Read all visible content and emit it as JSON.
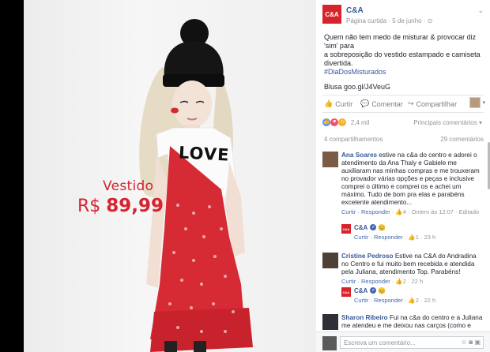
{
  "post_image": {
    "price_label": "Vestido",
    "currency": "R$",
    "price_value": "89,99",
    "shirt_text": "LOVE"
  },
  "header": {
    "page_name": "C&A",
    "logo_text": "C&A",
    "meta": "Página curtida · 5 de junho · ⊙",
    "menu_icon": "chevron-down-icon"
  },
  "post": {
    "line1": "Quem não tem medo de misturar & provocar diz 'sim' para",
    "line2": "a sobreposição do vestido estampado e camiseta divertida.",
    "hashtag": "#DiaDosMisturados",
    "line3": "Blusa goo.gl/J4VeuG"
  },
  "actions": {
    "like": "Curtir",
    "comment": "Comentar",
    "share": "Compartilhar"
  },
  "reactions": {
    "count": "2,4 mil",
    "sort": "Principais comentários ▾"
  },
  "shares": {
    "label": "4 compartilhamentos",
    "comments": "29 comentários"
  },
  "comments": [
    {
      "name": "Ana Soares",
      "text": "estive na c&a do centro e adorei o atendimento da Ana Thaly e Gabiele me auxiliaram nas minhas compras e me trouxeram no provador várias opções e peças e inclusive comprei o último e comprei os e achei um máximo. Tudo de bom pra elas e parabéns excelente atendimento...",
      "meta_reply": "Curtir · Responder",
      "meta_likes": "4",
      "meta_time": "Ontem às 12:07",
      "meta_edited": "Editado",
      "reply": {
        "name": "C&A",
        "reply_text": "😊",
        "meta": "Curtir · Responder",
        "likes": "1",
        "time": "23 h"
      }
    },
    {
      "name": "Cristine Pedroso",
      "text": "Estive na C&A do Andradina no Centro e fui muito bem recebida e atendida pela Juliana, atendimento Top. Parabéns!",
      "meta_reply": "Curtir · Responder",
      "meta_likes": "2",
      "meta_time": "22 h",
      "reply": {
        "name": "C&A",
        "reply_text": "😊",
        "meta": "Curtir · Responder",
        "likes": "2",
        "time": "22 h"
      }
    },
    {
      "name": "Sharon Ribeiro",
      "text": "Fui na c&a do centro e a Juliana me atendeu e me deixou nas carços (como e"
    }
  ],
  "input": {
    "placeholder": "Escreva um comentário..."
  },
  "colors": {
    "brand_red": "#d8232a",
    "link_blue": "#365899",
    "price_red": "#d5232f"
  }
}
